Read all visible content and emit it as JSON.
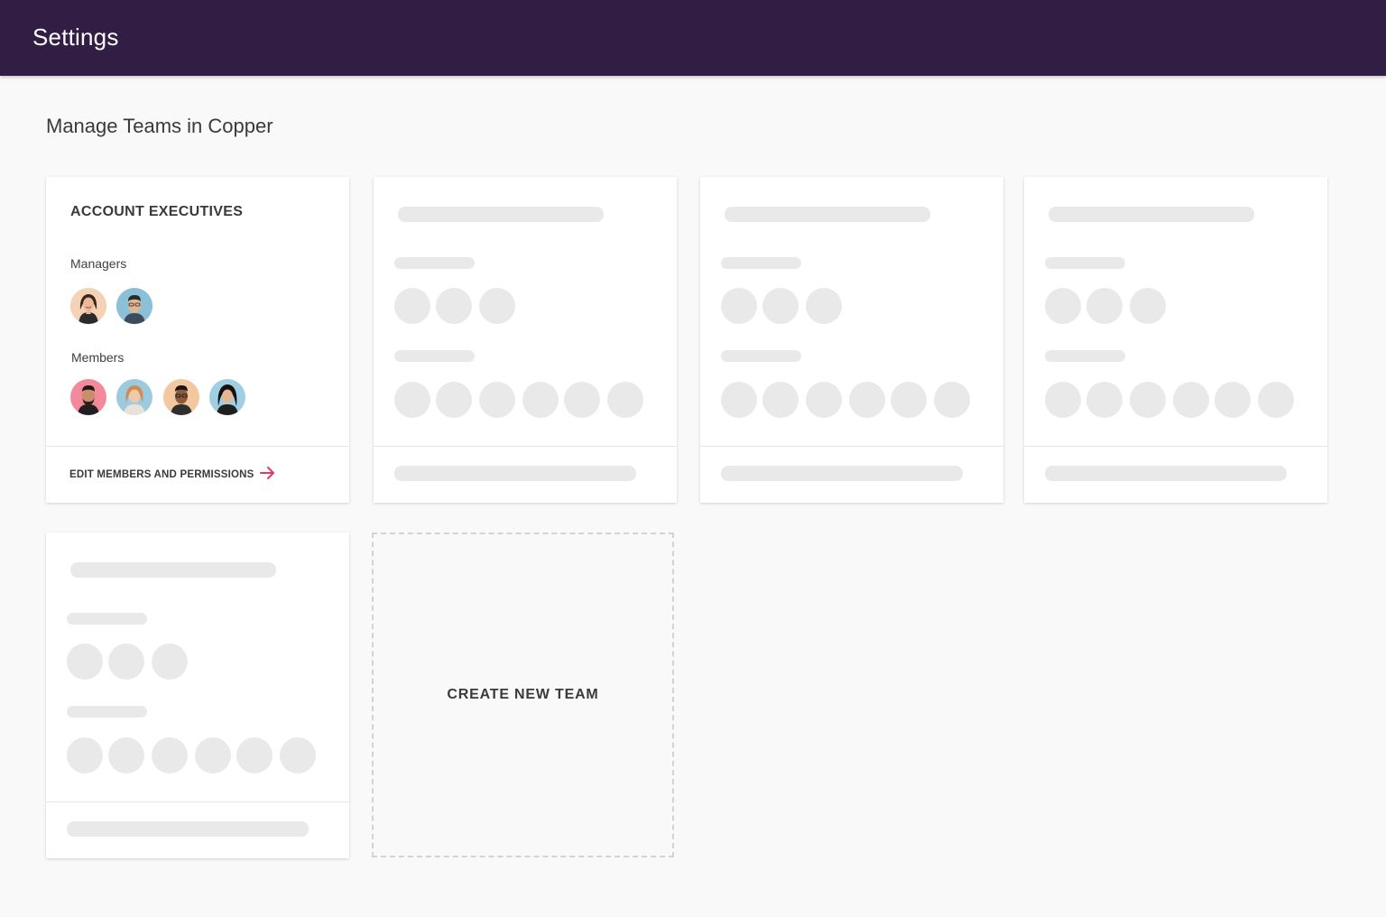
{
  "header": {
    "title": "Settings",
    "background": "#321e45"
  },
  "page": {
    "heading": "Manage Teams in Copper"
  },
  "team_card": {
    "title": "ACCOUNT EXECUTIVES",
    "managers_label": "Managers",
    "members_label": "Members",
    "edit_link": "EDIT MEMBERS AND PERMISSIONS",
    "edit_icon": "arrow-right-icon",
    "accent": "#e8365d"
  },
  "create_team": {
    "label": "CREATE NEW TEAM"
  }
}
